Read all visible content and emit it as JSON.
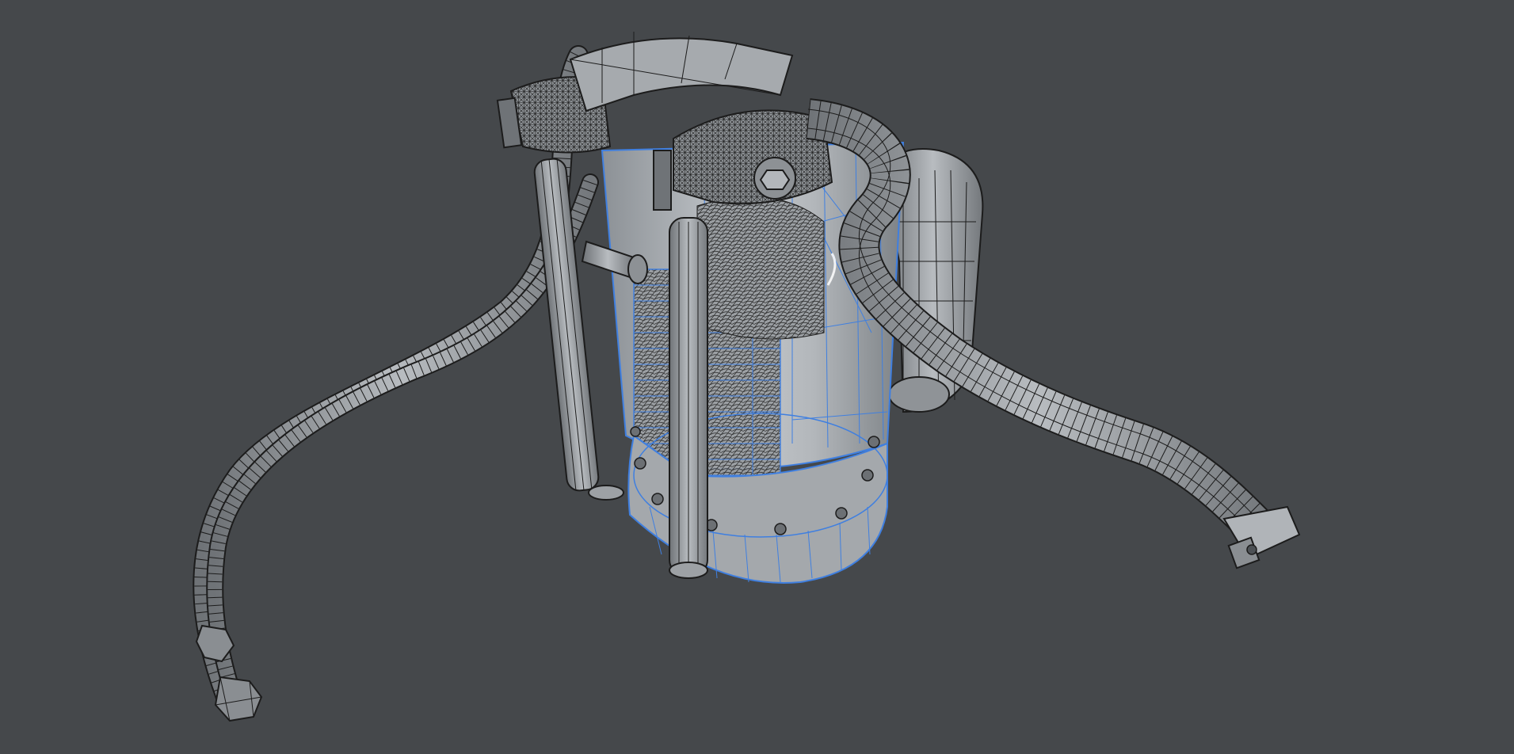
{
  "viewport": {
    "background_color": "#45484b",
    "display_mode": "wireframe-on-shaded",
    "selection_color": "#3f7fe0",
    "wire_color": "#1c1c1c",
    "surface_color": "#a9acaf"
  },
  "model": {
    "parts": [
      "chamber-body-icon",
      "base-flange-icon",
      "flange-bolt-icon",
      "support-leg-icon",
      "feed-line-icon",
      "exhaust-pipe-icon",
      "manifold-icon",
      "elbow-duct-icon"
    ]
  }
}
